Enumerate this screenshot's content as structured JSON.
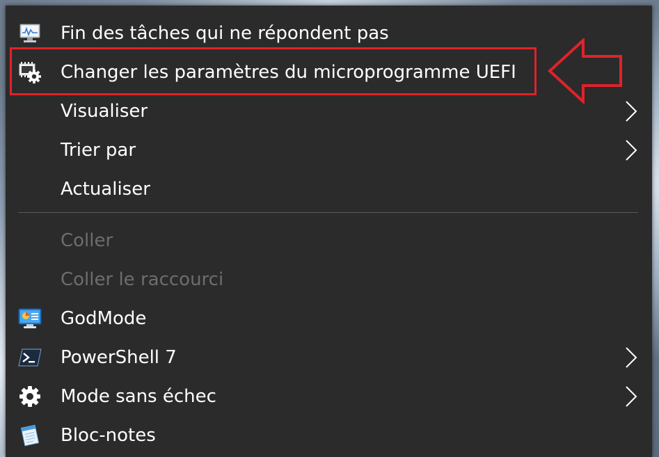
{
  "menu": {
    "items": [
      {
        "label": "Fin des tâches qui ne répondent pas",
        "icon": "monitor-task-icon",
        "enabled": true,
        "submenu": false
      },
      {
        "label": "Changer les paramètres du microprogramme UEFI",
        "icon": "uefi-chip-gear-icon",
        "enabled": true,
        "submenu": false
      },
      {
        "label": "Visualiser",
        "icon": null,
        "enabled": true,
        "submenu": true
      },
      {
        "label": "Trier par",
        "icon": null,
        "enabled": true,
        "submenu": true
      },
      {
        "label": "Actualiser",
        "icon": null,
        "enabled": true,
        "submenu": false
      },
      {
        "label": "Coller",
        "icon": null,
        "enabled": false,
        "submenu": false
      },
      {
        "label": "Coller le raccourci",
        "icon": null,
        "enabled": false,
        "submenu": false
      },
      {
        "label": "GodMode",
        "icon": "control-panel-icon",
        "enabled": true,
        "submenu": false
      },
      {
        "label": "PowerShell 7",
        "icon": "powershell-icon",
        "enabled": true,
        "submenu": true
      },
      {
        "label": "Mode sans échec",
        "icon": "gear-icon",
        "enabled": true,
        "submenu": true
      },
      {
        "label": "Bloc-notes",
        "icon": "notepad-icon",
        "enabled": true,
        "submenu": false
      }
    ]
  },
  "annotation": {
    "highlighted_item": "Changer les paramètres du microprogramme UEFI",
    "color": "#e0222a"
  },
  "colors": {
    "menu_background": "#2b2b2b",
    "text": "#ffffff",
    "disabled_text": "#6d6d6d",
    "separator": "#5a5a5a"
  }
}
